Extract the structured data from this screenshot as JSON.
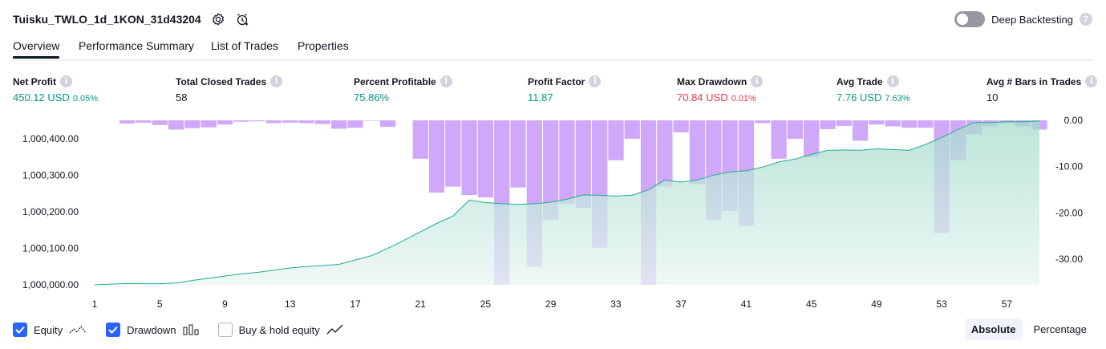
{
  "header": {
    "title": "Tuisku_TWLO_1d_1KON_31d43204",
    "settings_icon": "gear-icon",
    "alert_icon": "add-alert-icon",
    "deep_backtesting_label": "Deep Backtesting",
    "deep_backtesting_on": false
  },
  "tabs": [
    {
      "label": "Overview",
      "active": true
    },
    {
      "label": "Performance Summary",
      "active": false
    },
    {
      "label": "List of Trades",
      "active": false
    },
    {
      "label": "Properties",
      "active": false
    }
  ],
  "stats": {
    "net_profit": {
      "label": "Net Profit",
      "value": "450.12 USD",
      "sub": "0.05%"
    },
    "total_closed_trades": {
      "label": "Total Closed Trades",
      "value": "58"
    },
    "percent_profitable": {
      "label": "Percent Profitable",
      "value": "75.86%"
    },
    "profit_factor": {
      "label": "Profit Factor",
      "value": "11.87"
    },
    "max_drawdown": {
      "label": "Max Drawdown",
      "value": "70.84 USD",
      "sub": "0.01%"
    },
    "avg_trade": {
      "label": "Avg Trade",
      "value": "7.76 USD",
      "sub": "7.63%"
    },
    "avg_bars": {
      "label": "Avg # Bars in Trades",
      "value": "10"
    }
  },
  "legend": {
    "equity_label": "Equity",
    "equity_checked": true,
    "drawdown_label": "Drawdown",
    "drawdown_checked": true,
    "buy_hold_label": "Buy & hold equity",
    "buy_hold_checked": false
  },
  "mode": {
    "absolute_label": "Absolute",
    "percentage_label": "Percentage",
    "selected": "Absolute"
  },
  "colors": {
    "equity_line": "#22ab94",
    "equity_fill_top": "#a6dccd",
    "equity_fill_bottom": "#e8f6f2",
    "drawdown_bar": "#cfa8f9",
    "drawdown_overlap": "#b5b2ec",
    "positive": "#089981",
    "negative": "#f23645",
    "accent": "#2962ff"
  },
  "chart_data": {
    "type": "area",
    "x_ticks": [
      "1",
      "5",
      "9",
      "13",
      "17",
      "21",
      "25",
      "29",
      "33",
      "37",
      "41",
      "45",
      "49",
      "53",
      "57"
    ],
    "left_ticks": [
      "1,000,400.00",
      "1,000,300.00",
      "1,000,200.00",
      "1,000,100.00",
      "1,000,000.00"
    ],
    "left_tick_values": [
      1000400,
      1000300,
      1000200,
      1000100,
      1000000
    ],
    "left_range": [
      1000000,
      1000450
    ],
    "right_ticks": [
      "0.00",
      "-10.00",
      "-20.00",
      "-30.00"
    ],
    "right_tick_values": [
      0,
      -10,
      -20,
      -30
    ],
    "right_range": [
      -35.5,
      0
    ],
    "trades": [
      0,
      1,
      2,
      3,
      4,
      5,
      6,
      7,
      8,
      9,
      10,
      11,
      12,
      13,
      14,
      15,
      16,
      17,
      18,
      19,
      20,
      21,
      22,
      23,
      24,
      25,
      26,
      27,
      28,
      29,
      30,
      31,
      32,
      33,
      34,
      35,
      36,
      37,
      38,
      39,
      40,
      41,
      42,
      43,
      44,
      45,
      46,
      47,
      48,
      49,
      50,
      51,
      52,
      53,
      54,
      55,
      56,
      57,
      58
    ],
    "series": [
      {
        "name": "Equity",
        "values": [
          1000000,
          1000002,
          1000004,
          1000003,
          1000003,
          1000005,
          1000012,
          1000018,
          1000024,
          1000030,
          1000034,
          1000040,
          1000046,
          1000050,
          1000053,
          1000056,
          1000068,
          1000080,
          1000100,
          1000122,
          1000145,
          1000168,
          1000188,
          1000232,
          1000225,
          1000222,
          1000220,
          1000222,
          1000226,
          1000234,
          1000246,
          1000245,
          1000243,
          1000245,
          1000260,
          1000287,
          1000281,
          1000287,
          1000300,
          1000309,
          1000312,
          1000322,
          1000336,
          1000344,
          1000357,
          1000368,
          1000369,
          1000368,
          1000372,
          1000370,
          1000368,
          1000384,
          1000403,
          1000425,
          1000444,
          1000444,
          1000446,
          1000446,
          1000448
        ]
      },
      {
        "name": "Drawdown",
        "values": [
          0,
          0,
          -0.7,
          -0.5,
          -1.0,
          -2.0,
          -1.7,
          -1.5,
          -0.9,
          -0.3,
          -0.2,
          -0.6,
          -0.5,
          -0.6,
          -0.8,
          -1.8,
          -1.6,
          -0.1,
          -1.4,
          0,
          -8.3,
          -15.6,
          -14.3,
          -16.1,
          -16.6,
          -35.5,
          -14.5,
          -31.6,
          -21.5,
          -18.1,
          -18.9,
          -27.5,
          -8.6,
          -4.0,
          -35.5,
          -14.3,
          -2.6,
          -13.8,
          -21.5,
          -19.6,
          -22.8,
          -0.6,
          -8.3,
          -4.0,
          -8.0,
          -1.9,
          -1.2,
          -4.4,
          -0.9,
          -1.3,
          -1.6,
          -1.6,
          -24.3,
          -8.6,
          -3.0,
          -1.3,
          -0.6,
          -1.3,
          -2.0
        ]
      }
    ],
    "grid": false,
    "legend_position": "bottom-left"
  }
}
